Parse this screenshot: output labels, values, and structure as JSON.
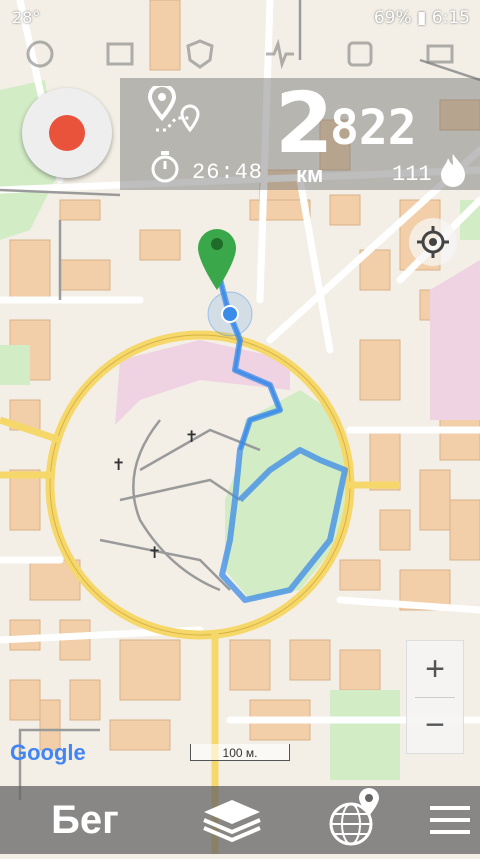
{
  "status": {
    "temperature": "28°",
    "battery": "69%",
    "time": "6:15"
  },
  "stats": {
    "distance_major": "2",
    "distance_minor": "822",
    "distance_unit": "км",
    "duration": "26:48",
    "calories": "111"
  },
  "map": {
    "scale_label": "100 м.",
    "attribution": "Google"
  },
  "controls": {
    "zoom_in": "+",
    "zoom_out": "−"
  },
  "bottom_bar": {
    "activity_mode": "Бег"
  },
  "icons": {
    "record": "record-icon",
    "locate": "crosshair-icon",
    "route": "route-icon",
    "timer": "timer-icon",
    "fire": "fire-icon",
    "layers": "layers-icon",
    "globe": "globe-pin-icon",
    "menu": "hamburger-menu-icon"
  },
  "colors": {
    "track": "#3b8be8",
    "record": "#e9523b",
    "park": "#d2ecc6",
    "ring_road": "#f6d86a",
    "pin": "#3aa84a"
  }
}
